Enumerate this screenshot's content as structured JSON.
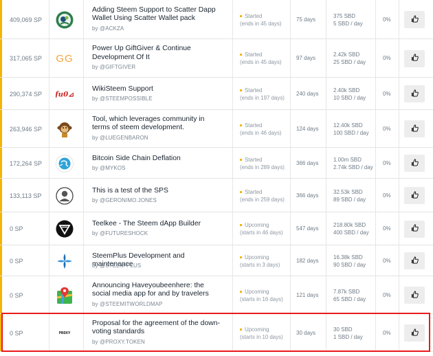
{
  "colors": {
    "accent": "#f4b400",
    "highlight": "#e81a1a"
  },
  "proposals": [
    {
      "votes": "409,069 SP",
      "title": "Adding Steem Support to Scatter Dapp Wallet Using Scatter Wallet pack",
      "author": "by @ACKZA",
      "status": "Started",
      "status_sub": "(ends in 45 days)",
      "days": "75 days",
      "total": "375 SBD",
      "daily": "5 SBD / day",
      "percent": "0%",
      "logo": "ackza-avatar",
      "vote_icon": "thumbs-up-icon"
    },
    {
      "votes": "317,065 SP",
      "title": "Power Up GiftGiver & Continue Development Of It",
      "author": "by @GIFTGIVER",
      "status": "Started",
      "status_sub": "(ends in 45 days)",
      "days": "97 days",
      "total": "2.42k SBD",
      "daily": "25 SBD / day",
      "percent": "0%",
      "logo": "gg-logo",
      "logo_text": "GG",
      "vote_icon": "thumbs-up-icon"
    },
    {
      "votes": "290,374 SP",
      "title": "WikiSteem Support",
      "author": "by @STEEMPOSSIBLE",
      "status": "Started",
      "status_sub": "(ends in 197 days)",
      "days": "240 days",
      "total": "2.40k SBD",
      "daily": "10 SBD / day",
      "percent": "0%",
      "logo": "steempossible-logo",
      "vote_icon": "thumbs-up-icon"
    },
    {
      "votes": "263,946 SP",
      "title": "Tool, which leverages community in terms of steem development.",
      "author": "by @LUEGENBARON",
      "status": "Started",
      "status_sub": "(ends in 46 days)",
      "days": "124 days",
      "total": "12.40k SBD",
      "daily": "100 SBD / day",
      "percent": "0%",
      "logo": "monkey-avatar",
      "vote_icon": "thumbs-up-icon"
    },
    {
      "votes": "172,264 SP",
      "title": "Bitcoin Side Chain Deflation",
      "author": "by @MYKOS",
      "status": "Started",
      "status_sub": "(ends in 289 days)",
      "days": "366 days",
      "total": "1.00m SBD",
      "daily": "2.74k SBD / day",
      "percent": "0%",
      "logo": "globe-avatar",
      "vote_icon": "thumbs-up-icon"
    },
    {
      "votes": "133,113 SP",
      "title": "This is a test of the SPS",
      "author": "by @GERONIMO.JONES",
      "status": "Started",
      "status_sub": "(ends in 259 days)",
      "days": "366 days",
      "total": "32.53k SBD",
      "daily": "89 SBD / day",
      "percent": "0%",
      "logo": "default-user-avatar",
      "vote_icon": "thumbs-up-icon"
    },
    {
      "votes": "0 SP",
      "title": "Teelkee - The Steem dApp Builder",
      "author": "by @FUTURESHOCK",
      "status": "Upcoming",
      "status_sub": "(starts in 46 days)",
      "days": "547 days",
      "total": "218.80k SBD",
      "daily": "400 SBD / day",
      "percent": "0%",
      "logo": "futureshock-logo",
      "vote_icon": "thumbs-up-icon"
    },
    {
      "votes": "0 SP",
      "title": "SteemPlus Development and maintenance",
      "author": "by @STEEM-PLUS",
      "status": "Upcoming",
      "status_sub": "(starts in 3 days)",
      "days": "182 days",
      "total": "16.38k SBD",
      "daily": "90 SBD / day",
      "percent": "0%",
      "logo": "steemplus-logo",
      "vote_icon": "thumbs-up-icon"
    },
    {
      "votes": "0 SP",
      "title": "Announcing Haveyoubeenhere: the social media app for and by travelers",
      "author": "by @STEEMITWORLDMAP",
      "status": "Upcoming",
      "status_sub": "(starts in 16 days)",
      "days": "121 days",
      "total": "7.87k SBD",
      "daily": "65 SBD / day",
      "percent": "0%",
      "logo": "map-pin-logo",
      "vote_icon": "thumbs-up-icon"
    },
    {
      "votes": "0 SP",
      "title": "Proposal for the agreement of the down-voting standards",
      "author": "by @PROXY.TOKEN",
      "status": "Upcoming",
      "status_sub": "(starts in 10 days)",
      "days": "30 days",
      "total": "30 SBD",
      "daily": "1 SBD / day",
      "percent": "0%",
      "logo": "proxy-logo",
      "logo_text": "PROXY",
      "vote_icon": "thumbs-up-icon"
    }
  ]
}
